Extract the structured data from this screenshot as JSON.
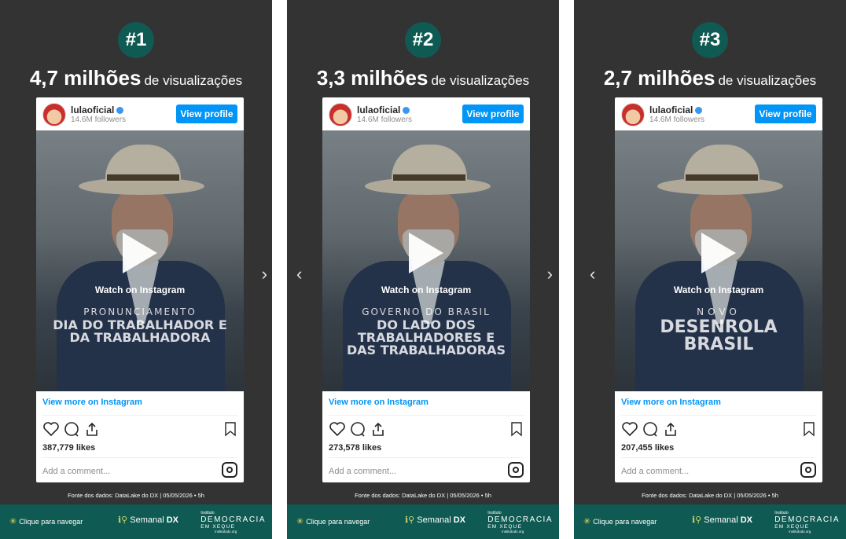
{
  "posts": [
    {
      "rank": "#1",
      "views_number": "4,7 milhões",
      "views_unit": "de visualizações",
      "username": "lulaoficial",
      "followers": "14.6M followers",
      "view_profile": "View profile",
      "watch": "Watch on Instagram",
      "overlay_kicker": "PRONUNCIAMENTO",
      "overlay_lines": [
        "DIA DO TRABALHADOR E",
        "DA TRABALHADORA"
      ],
      "view_more": "View more on Instagram",
      "likes": "387,779 likes",
      "comment_placeholder": "Add a comment..."
    },
    {
      "rank": "#2",
      "views_number": "3,3 milhões",
      "views_unit": "de visualizações",
      "username": "lulaoficial",
      "followers": "14.6M followers",
      "view_profile": "View profile",
      "watch": "Watch on Instagram",
      "overlay_kicker": "GOVERNO DO BRASIL",
      "overlay_lines": [
        "DO LADO DOS",
        "TRABALHADORES E",
        "DAS TRABALHADORAS"
      ],
      "view_more": "View more on Instagram",
      "likes": "273,578 likes",
      "comment_placeholder": "Add a comment..."
    },
    {
      "rank": "#3",
      "views_number": "2,7 milhões",
      "views_unit": "de visualizações",
      "username": "lulaoficial",
      "followers": "14.6M followers",
      "view_profile": "View profile",
      "watch": "Watch on Instagram",
      "overlay_kicker": "NOVO",
      "overlay_lines": [
        "DESENROLA",
        "BRASIL"
      ],
      "view_more": "View more on Instagram",
      "likes": "207,455 likes",
      "comment_placeholder": "Add a comment..."
    }
  ],
  "footer": {
    "source": "Fonte dos dados: DataLake do DX | 05/05/2026 • 5h",
    "nav_hint": "Clique para navegar",
    "semanal_prefix": "Semanal",
    "semanal_bold": "DX",
    "institute_small": "Instituto",
    "brand_main": "DEMOCRACIA",
    "brand_sub": "EM XEQUE",
    "brand_url": "institutodx.org"
  },
  "arrows": {
    "next": "›",
    "prev": "‹"
  },
  "colors": {
    "panel_bg": "#333333",
    "accent_teal": "#0f5a52",
    "instagram_blue": "#0095f6"
  }
}
